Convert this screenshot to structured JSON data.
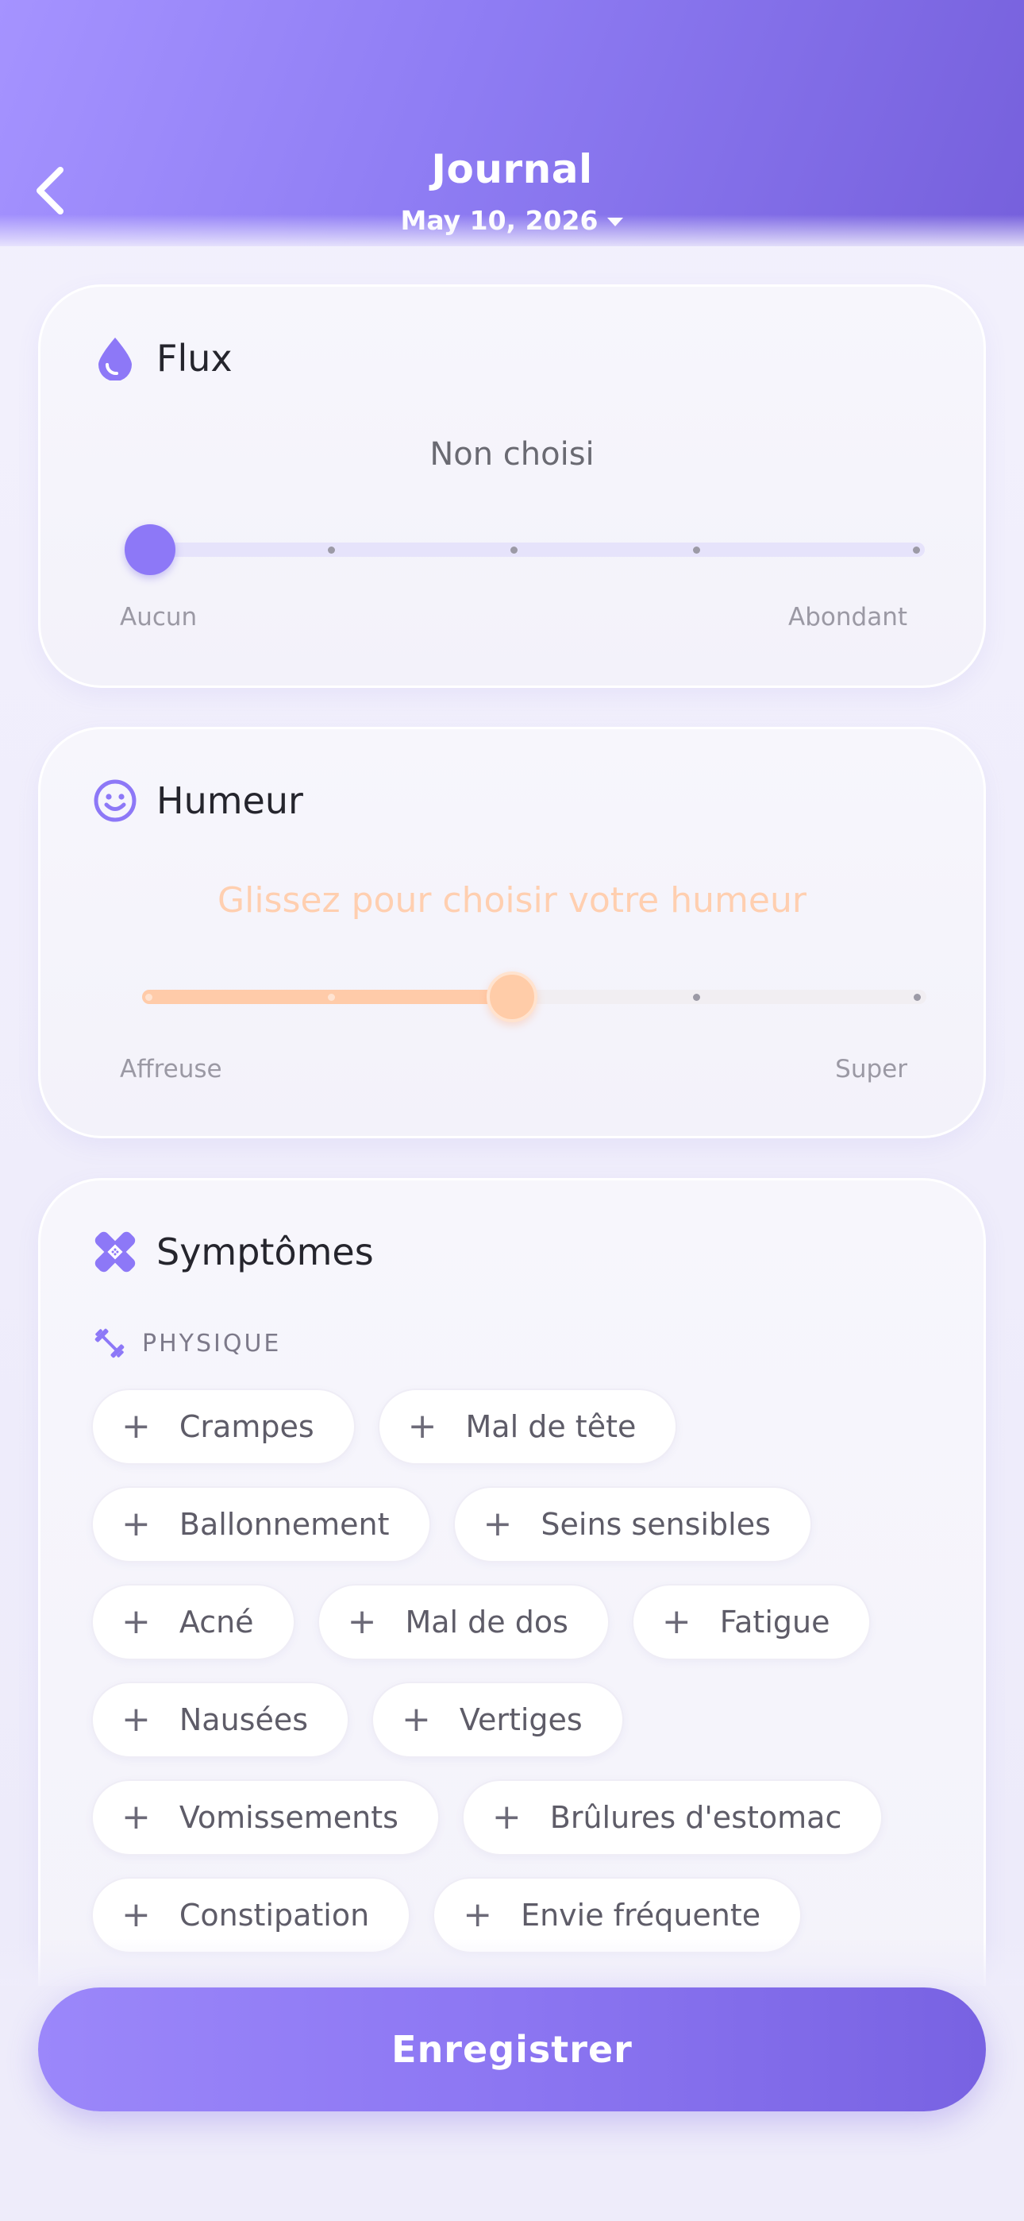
{
  "header": {
    "title": "Journal",
    "date": "May 10, 2026",
    "back_icon": "chevron-left-icon",
    "date_icon": "caret-down-icon"
  },
  "flux": {
    "title": "Flux",
    "icon": "drop-icon",
    "value": "Non choisi",
    "min_label": "Aucun",
    "max_label": "Abondant",
    "level": 0,
    "steps": 5
  },
  "humeur": {
    "title": "Humeur",
    "icon": "smiley-icon",
    "prompt": "Glissez pour choisir votre humeur",
    "min_label": "Affreuse",
    "max_label": "Super",
    "level": 0.5,
    "steps": 5
  },
  "symptomes": {
    "title": "Symptômes",
    "icon": "bandage-icon",
    "section": {
      "label": "PHYSIQUE",
      "icon": "dumbbell-icon"
    },
    "rows": [
      [
        "Crampes",
        "Mal de tête"
      ],
      [
        "Ballonnement",
        "Seins sensibles"
      ],
      [
        "Acné",
        "Mal de dos",
        "Fatigue"
      ],
      [
        "Nausées",
        "Vertiges"
      ],
      [
        "Vomissements",
        "Brûlures d'estomac"
      ],
      [
        "Constipation",
        "Envie fréquente"
      ]
    ]
  },
  "actions": {
    "save_label": "Enregistrer"
  },
  "colors": {
    "primary": "#8d78f7",
    "mood": "#ffcba9",
    "header_start": "#a593ff",
    "header_end": "#7660dc"
  }
}
